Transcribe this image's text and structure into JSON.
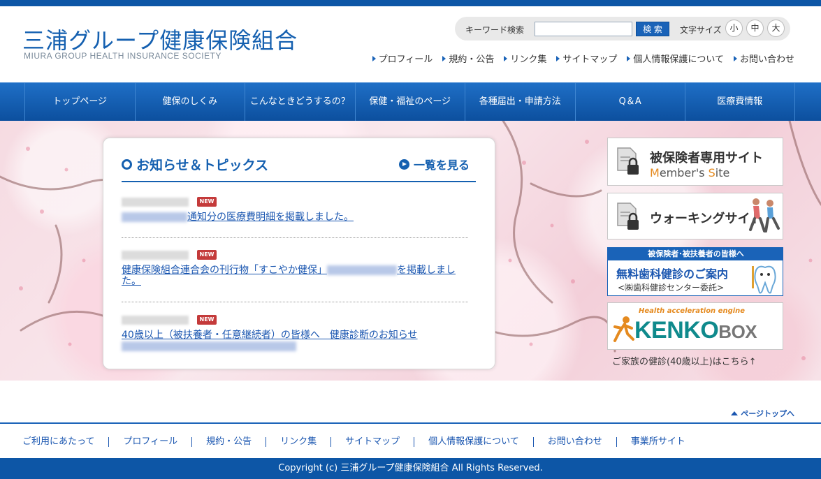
{
  "header": {
    "logo_title": "三浦グループ健康保険組合",
    "logo_subtitle": "MIURA GROUP HEALTH INSURANCE SOCIETY",
    "search": {
      "label": "キーワード検索",
      "value": "",
      "button": "検 索"
    },
    "font_size": {
      "label": "文字サイズ",
      "small": "小",
      "medium": "中",
      "large": "大"
    },
    "util_links": [
      "プロフィール",
      "規約・公告",
      "リンク集",
      "サイトマップ",
      "個人情報保護について",
      "お問い合わせ"
    ]
  },
  "global_nav": [
    "トップページ",
    "健保のしくみ",
    "こんなときどうするの？",
    "保健・福祉のページ",
    "各種届出・申請方法",
    "Q＆A",
    "医療費情報"
  ],
  "news": {
    "heading": "お知らせ＆トピックス",
    "see_all": "一覧を見る",
    "items": [
      {
        "badge": "NEW",
        "text": "通知分の医療費明細を掲載しました。"
      },
      {
        "badge": "NEW",
        "text_before": "健康保険組合連合会の刊行物「すこやか健保」",
        "text_after": "を掲載しました。"
      },
      {
        "badge": "NEW",
        "text": "40歳以上（被扶養者・任意継続者）の皆様へ　健康診断のお知らせ"
      }
    ]
  },
  "banners": {
    "member": {
      "title": "被保険者専用サイト",
      "sub_m": "M",
      "sub_1": "ember's ",
      "sub_s": "S",
      "sub_2": "ite"
    },
    "walking": {
      "title": "ウォーキングサイト"
    },
    "dental": {
      "strip": "被保険者･被扶養者の皆様へ",
      "title": "無料歯科健診のご案内",
      "sub": "<㈱歯科健診センター委託>"
    },
    "kenko": {
      "tagline": "Health acceleration engine",
      "main": "KENKO",
      "box": "BOX"
    },
    "family_note": "ご家族の健診(40歳以上)はこちら↑"
  },
  "page_top": "ページトップへ",
  "footer": {
    "links": [
      "ご利用にあたって",
      "プロフィール",
      "規約・公告",
      "リンク集",
      "サイトマップ",
      "個人情報保護について",
      "お問い合わせ",
      "事業所サイト"
    ],
    "copyright": "Copyright (c) 三浦グループ健康保険組合 All Rights Reserved."
  },
  "colors": {
    "brand_blue": "#0d56a6",
    "link_blue": "#1a56b0",
    "new_red": "#c43a3a",
    "accent_orange": "#e58a1f",
    "kenko_teal": "#0f8a8c"
  }
}
